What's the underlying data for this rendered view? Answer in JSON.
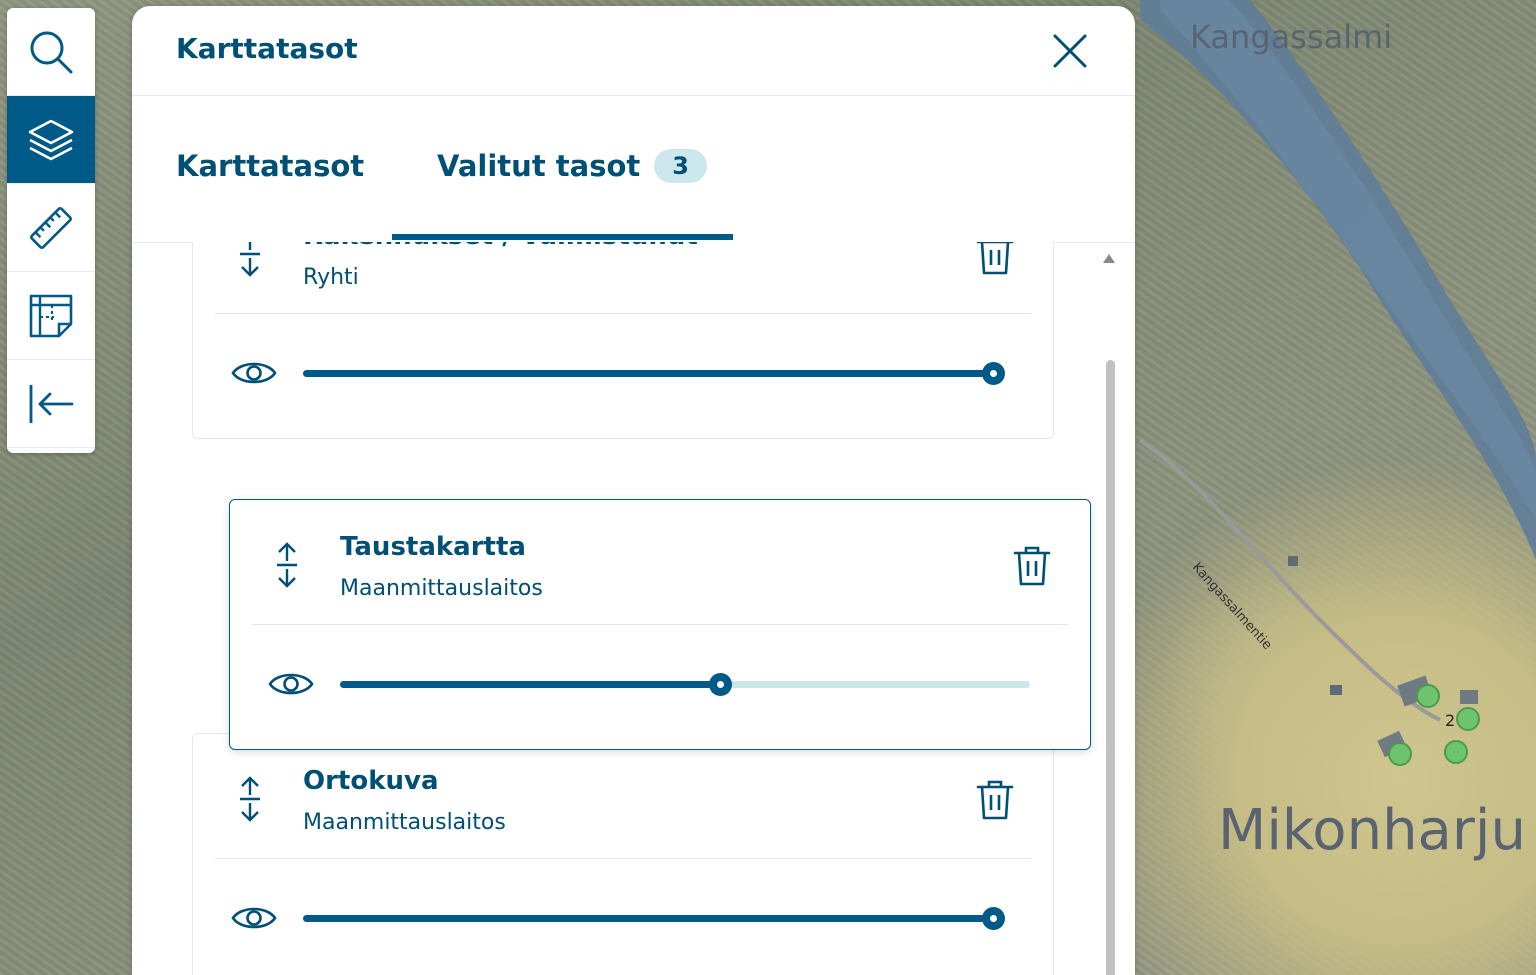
{
  "map": {
    "place_names": [
      "Kangassalmi",
      "Mikonharju"
    ],
    "road_label": "Kangassalmentie",
    "marker_label": "2"
  },
  "toolbar": {
    "items": [
      {
        "name": "search",
        "icon": "search-icon",
        "active": false
      },
      {
        "name": "layers",
        "icon": "layers-icon",
        "active": true
      },
      {
        "name": "measure",
        "icon": "ruler-icon",
        "active": false
      },
      {
        "name": "notes",
        "icon": "note-grid-icon",
        "active": false
      },
      {
        "name": "collapse",
        "icon": "collapse-left-icon",
        "active": false
      }
    ]
  },
  "panel": {
    "title": "Karttatasot",
    "tabs": [
      {
        "label": "Karttatasot",
        "active": false
      },
      {
        "label": "Valitut tasot",
        "badge": "3",
        "active": true
      }
    ],
    "layers": [
      {
        "name": "Rakennukset / Valmistunut",
        "source": "Ryhti",
        "opacity": 1.0
      },
      {
        "name": "Taustakartta",
        "source": "Maanmittauslaitos",
        "opacity": 0.55
      },
      {
        "name": "Ortokuva",
        "source": "Maanmittauslaitos",
        "opacity": 1.0
      }
    ]
  },
  "colors": {
    "primary": "#005a87",
    "text": "#004f74",
    "badge_bg": "#cde8ec",
    "slider_track": "#cde5e8"
  }
}
